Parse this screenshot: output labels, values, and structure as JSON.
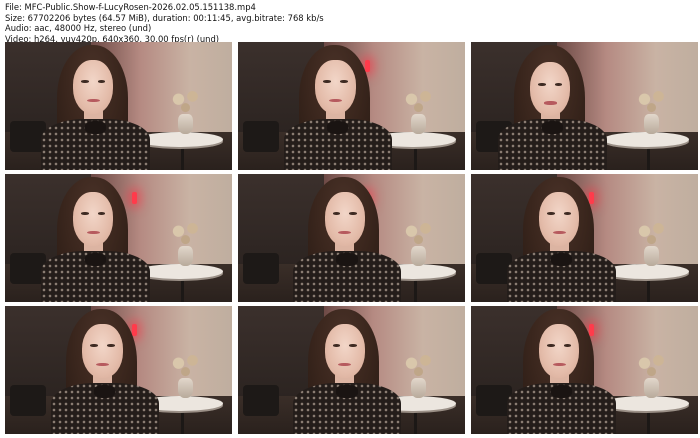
{
  "header": {
    "file": "File: MFC-Public.Show-f-LucyRosen-2026.02.05.151138.mp4",
    "size": "Size: 67702206 bytes (64.57 MiB), duration: 00:11:45, avg.bitrate: 768 kb/s",
    "audio": "Audio: aac, 48000 Hz, stereo (und)",
    "video": "Video: h264, yuv420p, 640x360, 30.00 fps(r) (und)"
  },
  "thumbnails": [
    {
      "index": 1
    },
    {
      "index": 2
    },
    {
      "index": 3
    },
    {
      "index": 4
    },
    {
      "index": 5
    },
    {
      "index": 6
    },
    {
      "index": 7
    },
    {
      "index": 8
    },
    {
      "index": 9
    }
  ],
  "colors": {
    "background": "#ffffff",
    "text": "#111111",
    "accent_light": "#ff3b4b"
  }
}
